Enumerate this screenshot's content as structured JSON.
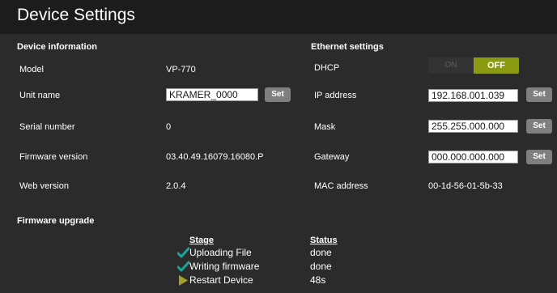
{
  "page": {
    "title": "Device Settings"
  },
  "device_info": {
    "section_title": "Device information",
    "model": {
      "label": "Model",
      "value": "VP-770"
    },
    "unit_name": {
      "label": "Unit name",
      "value": "KRAMER_0000",
      "set_label": "Set"
    },
    "serial": {
      "label": "Serial number",
      "value": "0"
    },
    "firmware": {
      "label": "Firmware version",
      "value": "03.40.49.16079.16080.P"
    },
    "web": {
      "label": "Web version",
      "value": "2.0.4"
    }
  },
  "ethernet": {
    "section_title": "Ethernet settings",
    "dhcp": {
      "label": "DHCP",
      "on_label": "ON",
      "off_label": "OFF",
      "state": "OFF"
    },
    "ip": {
      "label": "IP address",
      "value": "192.168.001.039",
      "set_label": "Set"
    },
    "mask": {
      "label": "Mask",
      "value": "255.255.000.000",
      "set_label": "Set"
    },
    "gateway": {
      "label": "Gateway",
      "value": "000.000.000.000",
      "set_label": "Set"
    },
    "mac": {
      "label": "MAC address",
      "value": "00-1d-56-01-5b-33"
    }
  },
  "firmware_upgrade": {
    "section_title": "Firmware upgrade",
    "stage_header": "Stage",
    "status_header": "Status",
    "rows": [
      {
        "icon": "check-icon",
        "stage": "Uploading File",
        "status": "done"
      },
      {
        "icon": "check-icon",
        "stage": "Writing firmware",
        "status": "done"
      },
      {
        "icon": "play-arrow-icon",
        "stage": "Restart Device",
        "status": "48s"
      }
    ]
  },
  "colors": {
    "background": "#2b2b2b",
    "title_bar": "#1c1c1c",
    "accent_green": "#8a9b12",
    "check_teal": "#1aa59a",
    "arrow_olive": "#a3a12a",
    "button_gray": "#7f7f7f"
  }
}
